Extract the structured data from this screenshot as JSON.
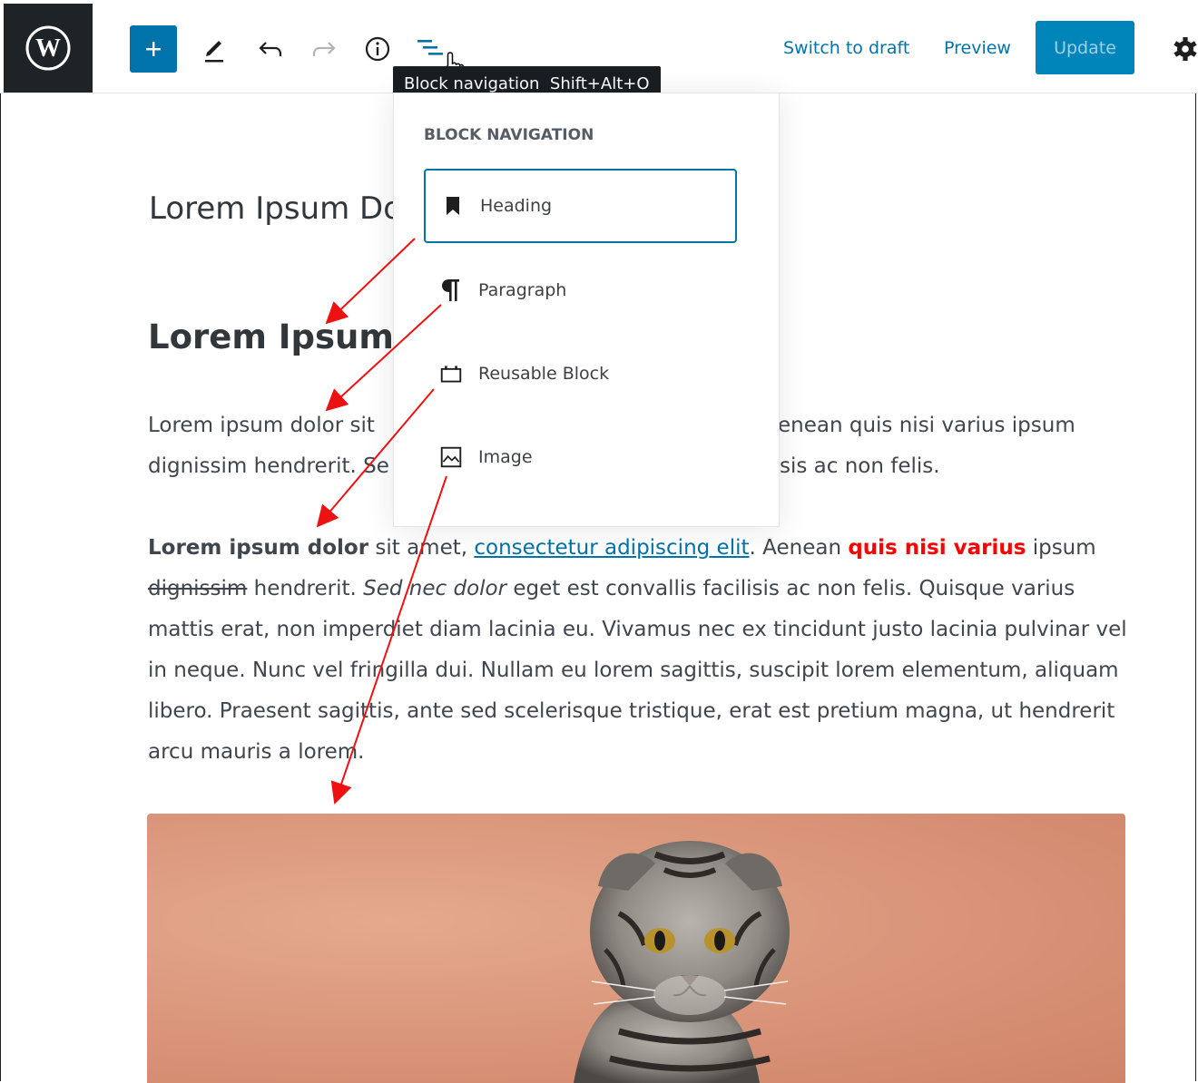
{
  "toolbar": {
    "logo": "W",
    "add_icon": "plus-icon",
    "tools_icon": "pencil-icon",
    "undo_icon": "undo-icon",
    "redo_icon": "redo-icon",
    "info_icon": "info-icon",
    "block_nav_icon": "block-navigation-icon",
    "switch_to_draft": "Switch to draft",
    "preview": "Preview",
    "update": "Update",
    "settings_icon": "gear-icon"
  },
  "tooltip": {
    "label": "Block navigation",
    "shortcut": "Shift+Alt+O"
  },
  "block_navigation": {
    "title": "Block Navigation",
    "items": [
      {
        "label": "Heading",
        "icon": "bookmark-icon",
        "active": true
      },
      {
        "label": "Paragraph",
        "icon": "pilcrow-icon",
        "active": false
      },
      {
        "label": "Reusable Block",
        "icon": "reusable-block-icon",
        "active": false
      },
      {
        "label": "Image",
        "icon": "image-icon",
        "active": false
      }
    ]
  },
  "editor": {
    "post_title": "Lorem Ipsum Do",
    "heading": "Lorem Ipsum",
    "paragraph1": {
      "line1_left": "Lorem ipsum dolor sit",
      "line1_right": "enean quis nisi varius ipsum",
      "line2_left": "dignissim hendrerit. Se",
      "line2_right": "sis ac non felis."
    },
    "paragraph2": {
      "bold": "Lorem ipsum dolor",
      "text1": " sit amet, ",
      "link": "consectetur adipiscing elit",
      "text2": ". Aenean ",
      "red": "quis nisi varius",
      "text3": " ipsum ",
      "strike": "dignissim",
      "text4": " hendrerit. ",
      "italic": "Sed nec dolor",
      "text5": " eget est convallis facilisis ac non felis. Quisque varius mattis erat, non imperdiet diam lacinia eu. Vivamus nec ex tincidunt justo lacinia pulvinar vel in neque. Nunc vel fringilla dui. Nullam eu lorem sagittis, suscipit lorem elementum, aliquam libero. Praesent sagittis, ante sed scelerisque tristique, erat est pretium magna, ut hendrerit arcu mauris a lorem."
    }
  },
  "colors": {
    "accent": "#0073aa",
    "arrow": "#ee1111",
    "highlight_text": "#ff0000"
  }
}
